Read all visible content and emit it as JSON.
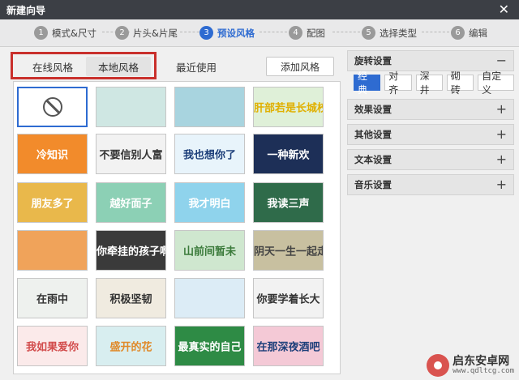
{
  "window": {
    "title": "新建向导",
    "close_label": "✕"
  },
  "steps": [
    {
      "num": "1",
      "label": "模式&尺寸"
    },
    {
      "num": "2",
      "label": "片头&片尾"
    },
    {
      "num": "3",
      "label": "预设风格"
    },
    {
      "num": "4",
      "label": "配图"
    },
    {
      "num": "5",
      "label": "选择类型"
    },
    {
      "num": "6",
      "label": "编辑"
    }
  ],
  "tabs": {
    "online": "在线风格",
    "local": "本地风格",
    "recent": "最近使用",
    "add_button": "添加风格"
  },
  "thumbnails": [
    {
      "text": "",
      "kind": "none",
      "bg": "#ffffff",
      "fg": "#333333"
    },
    {
      "text": "",
      "bg": "#cfe7e3",
      "fg": "#2a2a2a"
    },
    {
      "text": "",
      "bg": "#a8d4df",
      "fg": "#ffffff"
    },
    {
      "text": "肝部若是长城校",
      "bg": "#dff0d8",
      "fg": "#e0b000"
    },
    {
      "text": "冷知识",
      "bg": "#f28b2b",
      "fg": "#ffffff"
    },
    {
      "text": "不要信别人富",
      "bg": "#f2f2f2",
      "fg": "#333333"
    },
    {
      "text": "我也想你了",
      "bg": "#e8f4fb",
      "fg": "#1d3f7a"
    },
    {
      "text": "一种新欢",
      "bg": "#1d2f57",
      "fg": "#ffffff"
    },
    {
      "text": "朋友多了",
      "bg": "#e9b84b",
      "fg": "#ffffff"
    },
    {
      "text": "越好面子",
      "bg": "#8cd0b5",
      "fg": "#ffffff"
    },
    {
      "text": "我才明白",
      "bg": "#8fd3ec",
      "fg": "#ffffff"
    },
    {
      "text": "我读三声",
      "bg": "#2f6b4a",
      "fg": "#ffffff"
    },
    {
      "text": "",
      "bg": "#f0a35a",
      "fg": "#ffffff"
    },
    {
      "text": "你牵挂的孩子啊",
      "bg": "#3a3a3a",
      "fg": "#ffffff"
    },
    {
      "text": "山前间暂未",
      "bg": "#cfe7cf",
      "fg": "#3a7a3a"
    },
    {
      "text": "阴天一生一起走",
      "bg": "#c8c0a0",
      "fg": "#444444"
    },
    {
      "text": "在雨中",
      "bg": "#eef1ee",
      "fg": "#333333"
    },
    {
      "text": "积极坚韧",
      "bg": "#f0ebe0",
      "fg": "#333333"
    },
    {
      "text": "",
      "bg": "#dcecf6",
      "fg": "#2a6a9a"
    },
    {
      "text": "你要学着长大",
      "bg": "#f2f2f2",
      "fg": "#333333"
    },
    {
      "text": "我如果爱你",
      "bg": "#fbeaea",
      "fg": "#d24c4c"
    },
    {
      "text": "盛开的花",
      "bg": "#d8eef0",
      "fg": "#e08a2a"
    },
    {
      "text": "最真实的自己",
      "bg": "#2e8b45",
      "fg": "#ffffff"
    },
    {
      "text": "在那深夜酒吧",
      "bg": "#f4c9d6",
      "fg": "#1d3f7a"
    }
  ],
  "settings": {
    "rotation": {
      "title": "旋转设置",
      "toggle": "−",
      "options": [
        "经典",
        "对齐",
        "深井",
        "砌砖",
        "自定义"
      ]
    },
    "sections": [
      {
        "title": "效果设置",
        "toggle": "+"
      },
      {
        "title": "其他设置",
        "toggle": "+"
      },
      {
        "title": "文本设置",
        "toggle": "+"
      },
      {
        "title": "音乐设置",
        "toggle": "+"
      }
    ]
  },
  "watermark": {
    "name": "启东安卓网",
    "url": "www.qdltcg.com"
  },
  "colors": {
    "accent": "#2e6bd1",
    "highlight": "#c9302c"
  }
}
